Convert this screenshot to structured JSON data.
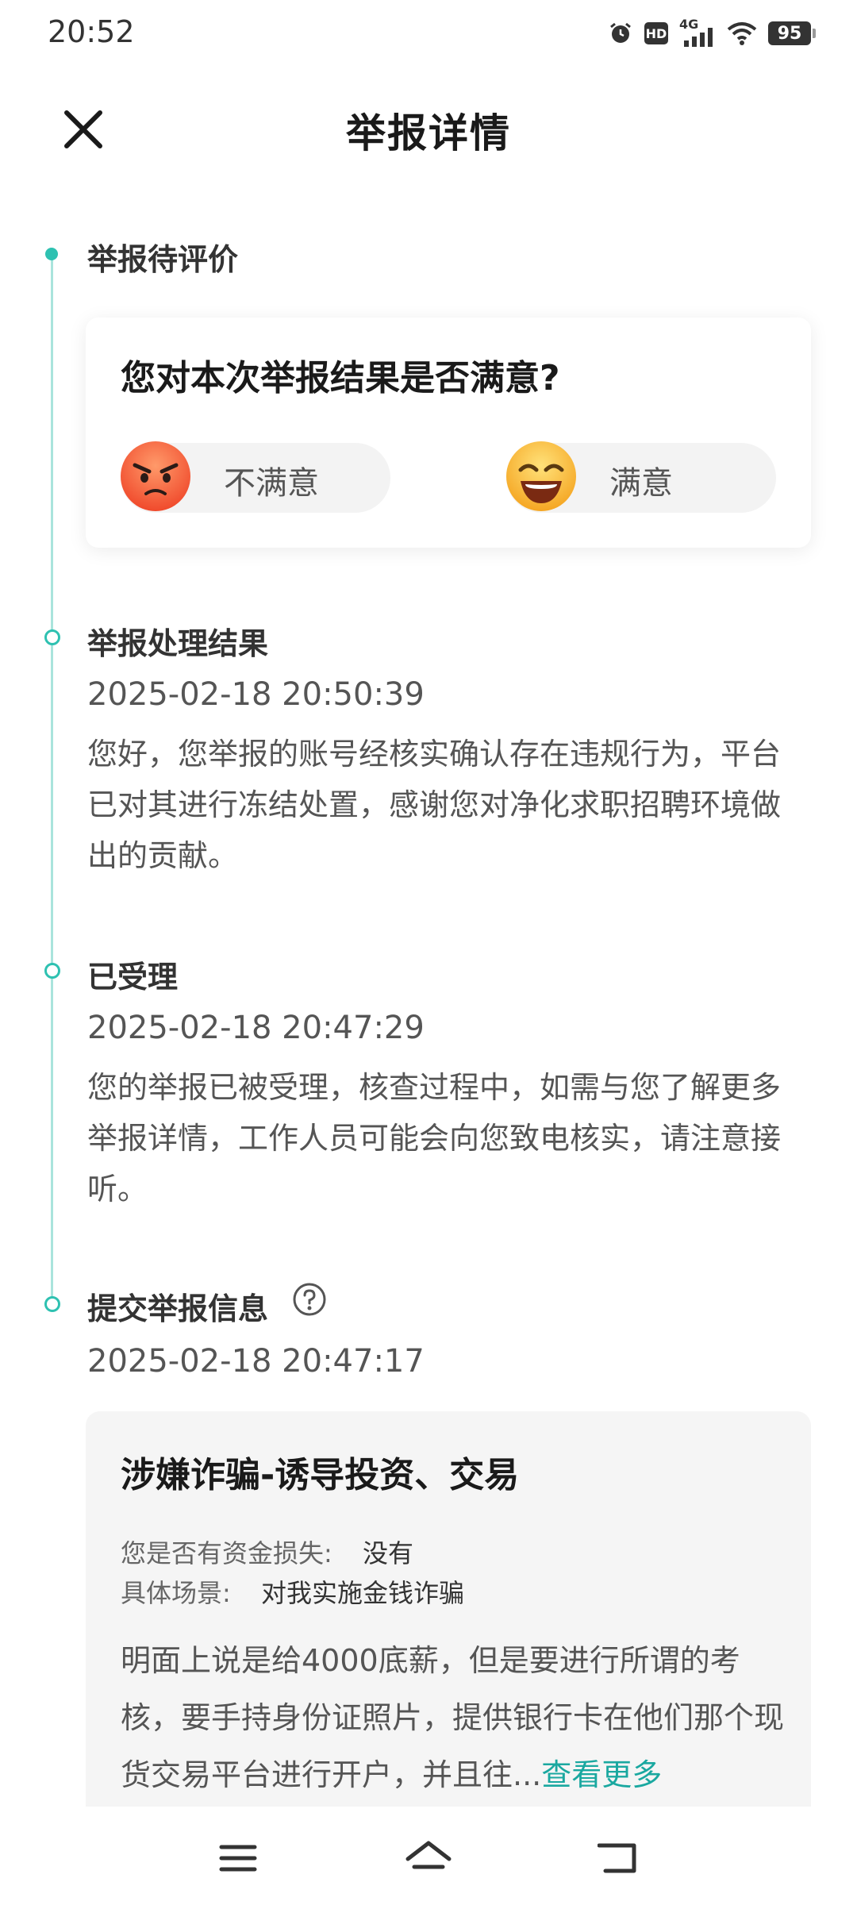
{
  "status": {
    "time": "20:52",
    "battery": "95",
    "hd": "HD",
    "network": "4G"
  },
  "header": {
    "title": "举报详情"
  },
  "rating": {
    "section_title": "举报待评价",
    "question": "您对本次举报结果是否满意?",
    "options": [
      {
        "label": "不满意"
      },
      {
        "label": "满意"
      }
    ]
  },
  "timeline": [
    {
      "title": "举报处理结果",
      "time": "2025-02-18 20:50:39",
      "text": "您好，您举报的账号经核实确认存在违规行为，平台已对其进行冻结处置，感谢您对净化求职招聘环境做出的贡献。"
    },
    {
      "title": "已受理",
      "time": "2025-02-18 20:47:29",
      "text": "您的举报已被受理，核查过程中，如需与您了解更多举报详情，工作人员可能会向您致电核实，请注意接听。"
    },
    {
      "title": "提交举报信息",
      "time": "2025-02-18 20:47:17"
    }
  ],
  "report": {
    "title": "涉嫌诈骗-诱导投资、交易",
    "loss_label": "您是否有资金损失:",
    "loss_value": "没有",
    "scene_label": "具体场景:",
    "scene_value": "对我实施金钱诈骗",
    "description": "明面上说是给4000底薪，但是要进行所谓的考核，要手持身份证照片，提供银行卡在他们那个现货交易平台进行开户，并且往...",
    "more_link": "查看更多"
  },
  "colors": {
    "accent": "#2ec1b1",
    "link": "#1aa8a0"
  }
}
